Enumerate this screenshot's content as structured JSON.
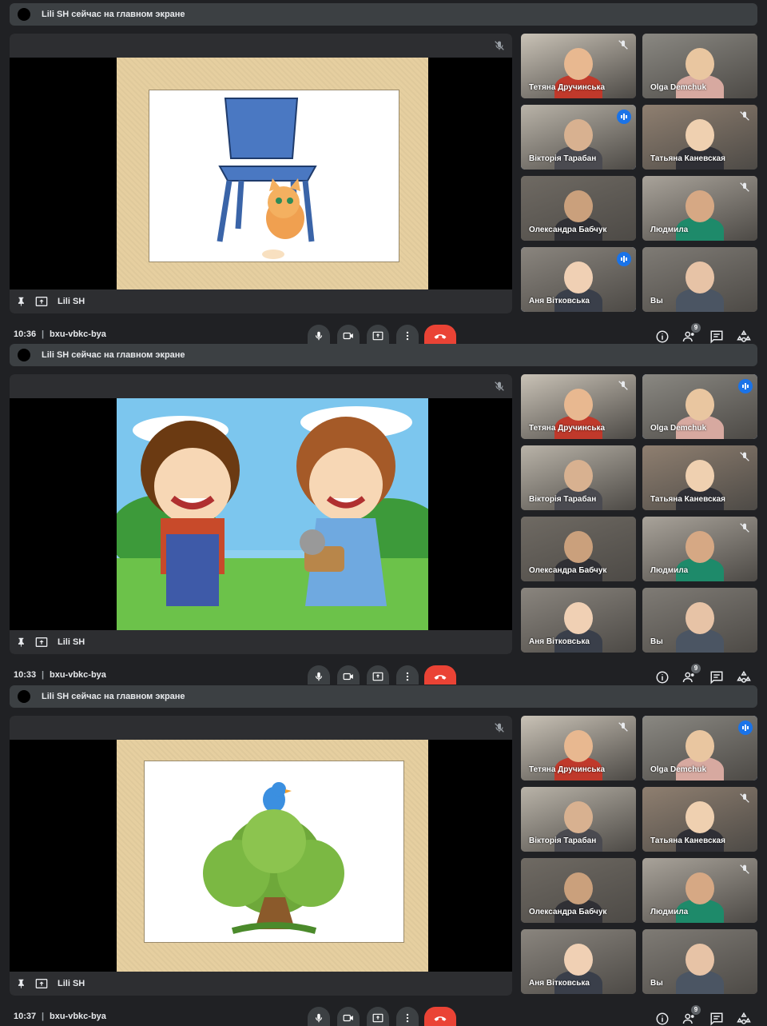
{
  "panels": [
    {
      "banner": "Lili SH сейчас на главном экране",
      "presenter": "Lili SH",
      "time": "10:36",
      "meeting_code": "bxu-vbkc-bya",
      "participant_count": "9",
      "slide_scene": "chair-cat",
      "tiles": [
        {
          "name": "Тетяна Дручинська",
          "muted": true,
          "speaking": false
        },
        {
          "name": "Olga Demchuk",
          "muted": false,
          "speaking": false
        },
        {
          "name": "Вікторія Тарабан",
          "muted": false,
          "speaking": true
        },
        {
          "name": "Татьяна Каневская",
          "muted": true,
          "speaking": false
        },
        {
          "name": "Олександра Бабчук",
          "muted": false,
          "speaking": false
        },
        {
          "name": "Людмила",
          "muted": true,
          "speaking": false
        },
        {
          "name": "Аня Вітковська",
          "muted": false,
          "speaking": true
        },
        {
          "name": "Вы",
          "muted": false,
          "speaking": false
        }
      ]
    },
    {
      "banner": "Lili SH сейчас на главном экране",
      "presenter": "Lili SH",
      "time": "10:33",
      "meeting_code": "bxu-vbkc-bya",
      "participant_count": "9",
      "slide_scene": "kids",
      "tiles": [
        {
          "name": "Тетяна Дручинська",
          "muted": true,
          "speaking": false
        },
        {
          "name": "Olga Demchuk",
          "muted": false,
          "speaking": true
        },
        {
          "name": "Вікторія Тарабан",
          "muted": false,
          "speaking": false
        },
        {
          "name": "Татьяна Каневская",
          "muted": true,
          "speaking": false
        },
        {
          "name": "Олександра Бабчук",
          "muted": false,
          "speaking": false
        },
        {
          "name": "Людмила",
          "muted": true,
          "speaking": false
        },
        {
          "name": "Аня Вітковська",
          "muted": false,
          "speaking": false
        },
        {
          "name": "Вы",
          "muted": false,
          "speaking": false
        }
      ]
    },
    {
      "banner": "Lili SH сейчас на главном экране",
      "presenter": "Lili SH",
      "time": "10:37",
      "meeting_code": "bxu-vbkc-bya",
      "participant_count": "9",
      "slide_scene": "bird-bush",
      "tiles": [
        {
          "name": "Тетяна Дручинська",
          "muted": true,
          "speaking": false
        },
        {
          "name": "Olga Demchuk",
          "muted": false,
          "speaking": true
        },
        {
          "name": "Вікторія Тарабан",
          "muted": false,
          "speaking": false
        },
        {
          "name": "Татьяна Каневская",
          "muted": true,
          "speaking": false
        },
        {
          "name": "Олександра Бабчук",
          "muted": false,
          "speaking": false
        },
        {
          "name": "Людмила",
          "muted": true,
          "speaking": false
        },
        {
          "name": "Аня Вітковська",
          "muted": false,
          "speaking": false
        },
        {
          "name": "Вы",
          "muted": false,
          "speaking": false
        }
      ]
    }
  ],
  "icons": {
    "mic": "mic-icon",
    "camera": "camera-icon",
    "present": "present-screen-icon",
    "more": "more-vert-icon",
    "hangup": "hangup-icon",
    "info": "info-icon",
    "people": "people-icon",
    "chat": "chat-icon",
    "activities": "activities-icon"
  },
  "colors": {
    "background": "#202124",
    "bar": "#3c4043",
    "speaking_accent": "#8ab4f8",
    "hangup": "#ea4335",
    "talk_badge": "#1a73e8"
  }
}
